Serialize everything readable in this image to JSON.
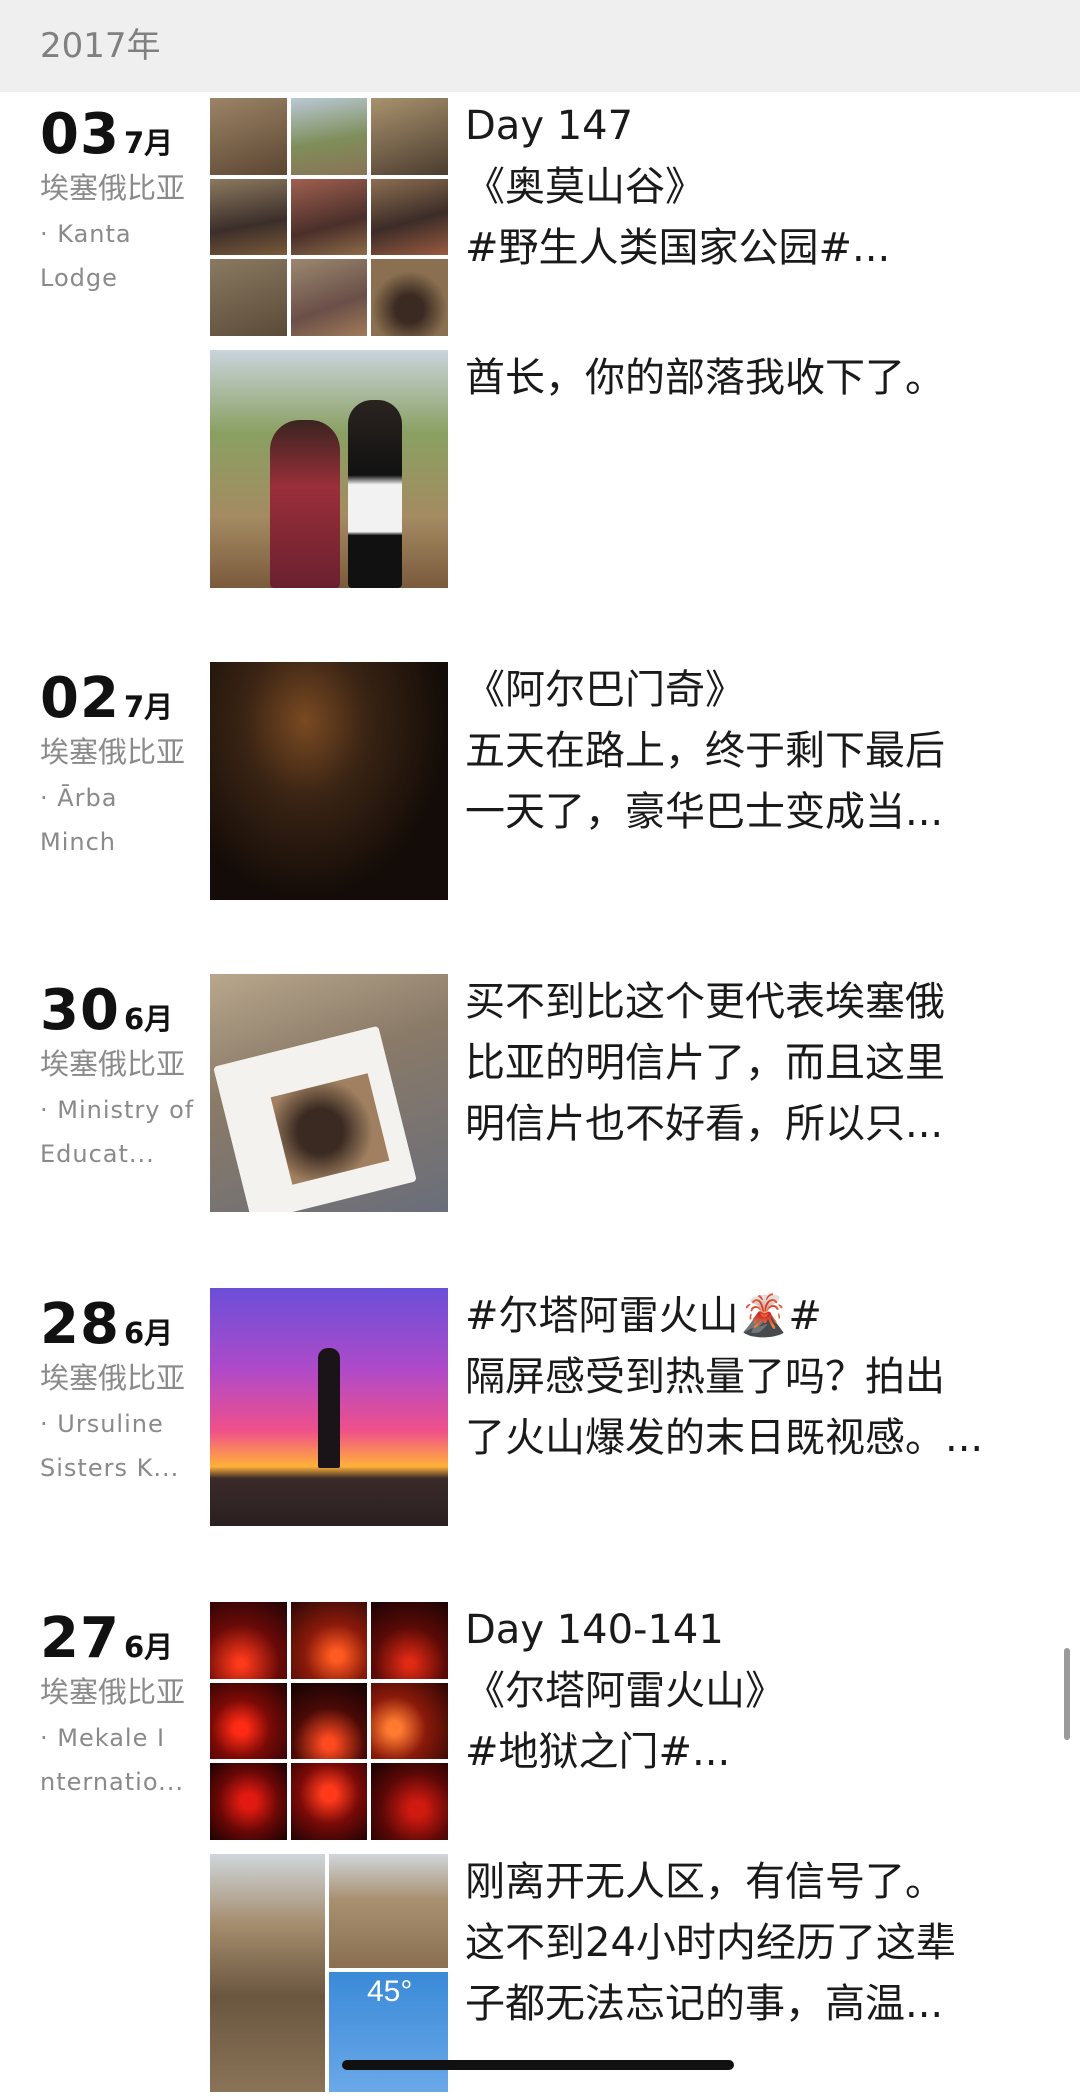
{
  "header": {
    "year": "2017年"
  },
  "entries": [
    {
      "day": "03",
      "month": "7月",
      "location": "埃塞俄比亚",
      "place": "· Kanta Lodge",
      "posts": [
        {
          "text": [
            "Day 147",
            "《奥莫山谷》",
            "#野生人类国家公园#..."
          ],
          "photo": "tribe-photo-grid"
        },
        {
          "text": [
            "酋长，你的部落我收下了。"
          ],
          "photo": "chief-photo"
        }
      ]
    },
    {
      "day": "02",
      "month": "7月",
      "location": "埃塞俄比亚",
      "place": "· Ārba Minch",
      "posts": [
        {
          "text": [
            "《阿尔巴门奇》",
            "五天在路上，终于剩下最后",
            "一天了，豪华巴士变成当..."
          ],
          "photo": "bus-photo"
        }
      ]
    },
    {
      "day": "30",
      "month": "6月",
      "location": "埃塞俄比亚",
      "place": "· Ministry of Educat...",
      "posts": [
        {
          "text": [
            "买不到比这个更代表埃塞俄",
            "比亚的明信片了，而且这里",
            "明信片也不好看，所以只..."
          ],
          "photo": "postcards-photo"
        }
      ]
    },
    {
      "day": "28",
      "month": "6月",
      "location": "埃塞俄比亚",
      "place": "· Ursuline Sisters K...",
      "posts": [
        {
          "text": [
            "#尔塔阿雷火山🌋#",
            "隔屏感受到热量了吗？拍出",
            "了火山爆发的末日既视感。..."
          ],
          "photo": "volcano-sunset-photo"
        }
      ]
    },
    {
      "day": "27",
      "month": "6月",
      "location": "埃塞俄比亚",
      "place": "· Mekale I nternatio...",
      "posts": [
        {
          "text": [
            "Day 140-141",
            "《尔塔阿雷火山》",
            "#地狱之门#..."
          ],
          "photo": "lava-photo-grid"
        },
        {
          "text": [
            "刚离开无人区，有信号了。",
            "这不到24小时内经历了这辈",
            "子都无法忘记的事，高温..."
          ],
          "photo": "desert-photo-grid",
          "weather_temp": "45°"
        }
      ]
    }
  ],
  "colors": {
    "year_bar": "#efefef",
    "meta_text": "#8a8a8a"
  }
}
